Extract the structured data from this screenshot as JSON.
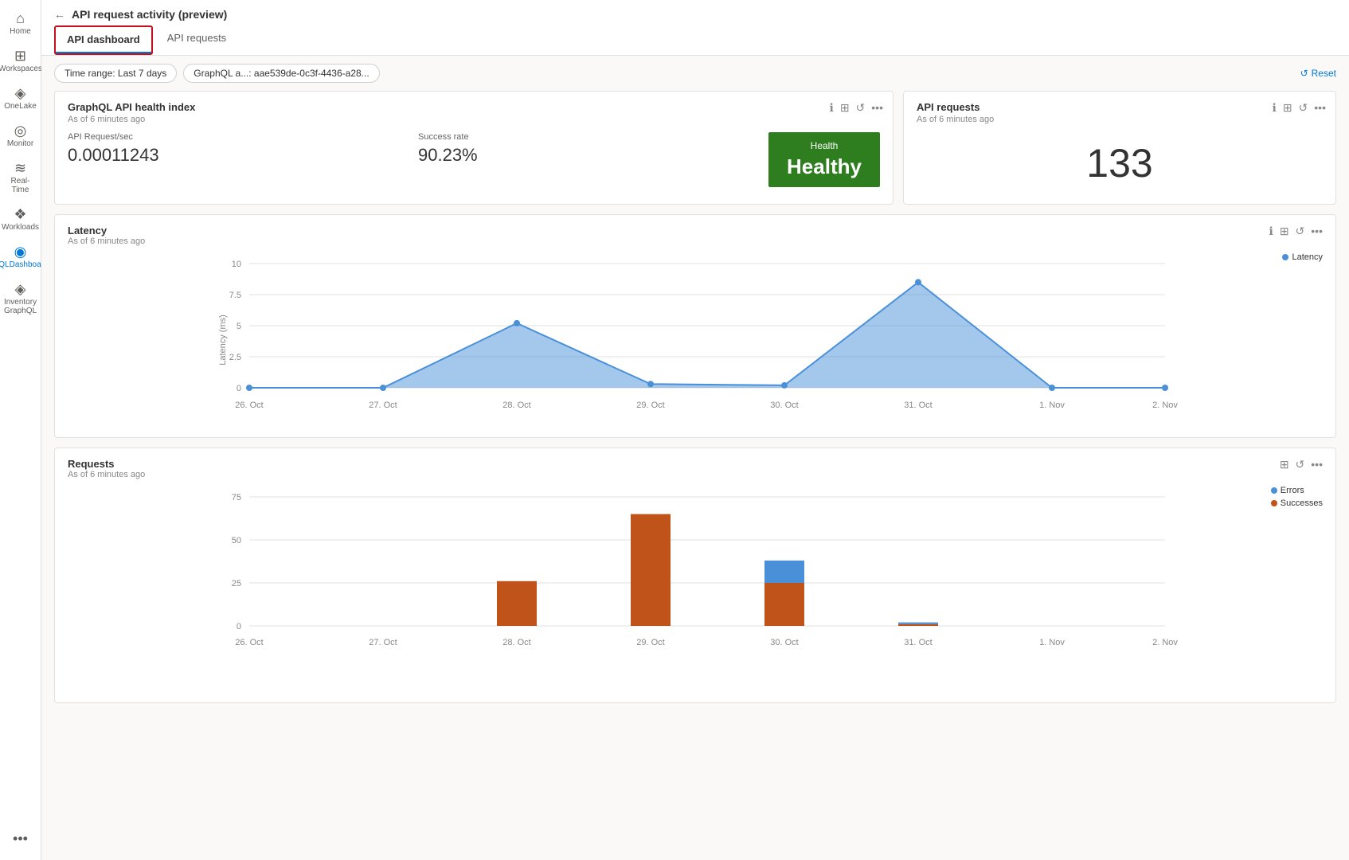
{
  "sidebar": {
    "items": [
      {
        "id": "home",
        "label": "Home",
        "icon": "⌂"
      },
      {
        "id": "workspaces",
        "label": "Workspaces",
        "icon": "⊞"
      },
      {
        "id": "onelake",
        "label": "OneLake",
        "icon": "◈"
      },
      {
        "id": "monitor",
        "label": "Monitor",
        "icon": "◎"
      },
      {
        "id": "realtime",
        "label": "Real-Time",
        "icon": "≋"
      },
      {
        "id": "workloads",
        "label": "Workloads",
        "icon": "❖"
      },
      {
        "id": "gqldashboard",
        "label": "GQLDashboard",
        "icon": "◉",
        "active": true
      },
      {
        "id": "inventorygraphql",
        "label": "Inventory GraphQL",
        "icon": "◈"
      },
      {
        "id": "more",
        "label": "...",
        "icon": "•••"
      }
    ]
  },
  "header": {
    "back_label": "←",
    "title": "API request activity (preview)",
    "tabs": [
      {
        "id": "dashboard",
        "label": "API dashboard",
        "active": true
      },
      {
        "id": "requests",
        "label": "API requests"
      }
    ]
  },
  "filters": {
    "time_range": "Time range: Last 7 days",
    "graphql_filter": "GraphQL a...: aae539de-0c3f-4436-a28...",
    "reset_label": "Reset"
  },
  "health_card": {
    "title": "GraphQL API health index",
    "subtitle": "As of 6 minutes ago",
    "api_request_per_sec_label": "API Request/sec",
    "api_request_per_sec_value": "0.00011243",
    "success_rate_label": "Success rate",
    "success_rate_value": "90.23%",
    "health_label": "Health",
    "health_value": "Healthy",
    "health_color": "#2e7d1e"
  },
  "api_requests_card": {
    "title": "API requests",
    "subtitle": "As of 6 minutes ago",
    "value": "133"
  },
  "latency_chart": {
    "title": "Latency",
    "subtitle": "As of 6 minutes ago",
    "y_label": "Latency (ms)",
    "y_ticks": [
      "10",
      "7.5",
      "5",
      "2.5",
      "0"
    ],
    "x_labels": [
      "26. Oct",
      "27. Oct",
      "28. Oct",
      "29. Oct",
      "30. Oct",
      "31. Oct",
      "1. Nov",
      "2. Nov"
    ],
    "legend_label": "Latency",
    "legend_color": "#4a90d9",
    "data_points": [
      {
        "x": 0,
        "y": 0
      },
      {
        "x": 1,
        "y": 0
      },
      {
        "x": 2,
        "y": 5.2
      },
      {
        "x": 3,
        "y": 0.3
      },
      {
        "x": 4,
        "y": 0.2
      },
      {
        "x": 5,
        "y": 8.5
      },
      {
        "x": 6,
        "y": 0
      },
      {
        "x": 7,
        "y": 0
      }
    ]
  },
  "requests_chart": {
    "title": "Requests",
    "subtitle": "As of 6 minutes ago",
    "y_ticks": [
      "75",
      "50",
      "25",
      "0"
    ],
    "x_labels": [
      "26. Oct",
      "27. Oct",
      "28. Oct",
      "29. Oct",
      "30. Oct",
      "31. Oct",
      "1. Nov",
      "2. Nov"
    ],
    "legend": [
      {
        "label": "Errors",
        "color": "#4a90d9"
      },
      {
        "label": "Successes",
        "color": "#c0531a"
      }
    ],
    "bars": [
      {
        "x_label": "26. Oct",
        "errors": 0,
        "successes": 0
      },
      {
        "x_label": "27. Oct",
        "errors": 0,
        "successes": 0
      },
      {
        "x_label": "28. Oct",
        "errors": 0,
        "successes": 26
      },
      {
        "x_label": "29. Oct",
        "errors": 0,
        "successes": 65
      },
      {
        "x_label": "30. Oct",
        "errors": 13,
        "successes": 25
      },
      {
        "x_label": "31. Oct",
        "errors": 1,
        "successes": 1
      },
      {
        "x_label": "1. Nov",
        "errors": 0,
        "successes": 0
      },
      {
        "x_label": "2. Nov",
        "errors": 0,
        "successes": 0
      }
    ]
  }
}
